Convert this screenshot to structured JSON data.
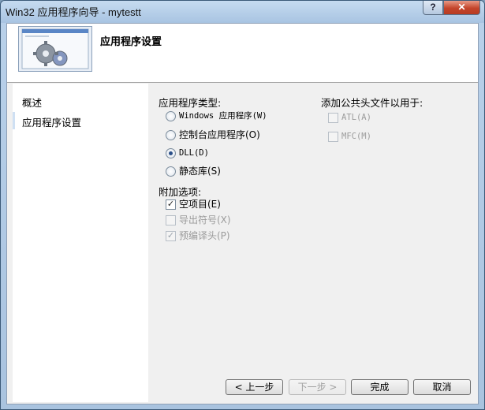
{
  "window": {
    "title": "Win32 应用程序向导 - mytestt"
  },
  "titlebar": {
    "help_label": "?",
    "close_label": "✕"
  },
  "header": {
    "title": "应用程序设置"
  },
  "nav": {
    "items": [
      {
        "label": "概述"
      },
      {
        "label": "应用程序设置"
      }
    ]
  },
  "app_type": {
    "label": "应用程序类型:",
    "options": [
      {
        "label": "Windows 应用程序(W)",
        "selected": false
      },
      {
        "label": "控制台应用程序(O)",
        "selected": false
      },
      {
        "label": "DLL(D)",
        "selected": true
      },
      {
        "label": "静态库(S)",
        "selected": false
      }
    ]
  },
  "additional": {
    "label": "附加选项:",
    "options": [
      {
        "label": "空项目(E)",
        "checked": true,
        "enabled": true
      },
      {
        "label": "导出符号(X)",
        "checked": false,
        "enabled": false
      },
      {
        "label": "预编译头(P)",
        "checked": true,
        "enabled": false
      }
    ]
  },
  "headers": {
    "label": "添加公共头文件以用于:",
    "options": [
      {
        "label": "ATL(A)",
        "checked": false,
        "enabled": false
      },
      {
        "label": "MFC(M)",
        "checked": false,
        "enabled": false
      }
    ]
  },
  "buttons": {
    "prev": "< 上一步",
    "next": "下一步 >",
    "finish": "完成",
    "cancel": "取消"
  }
}
